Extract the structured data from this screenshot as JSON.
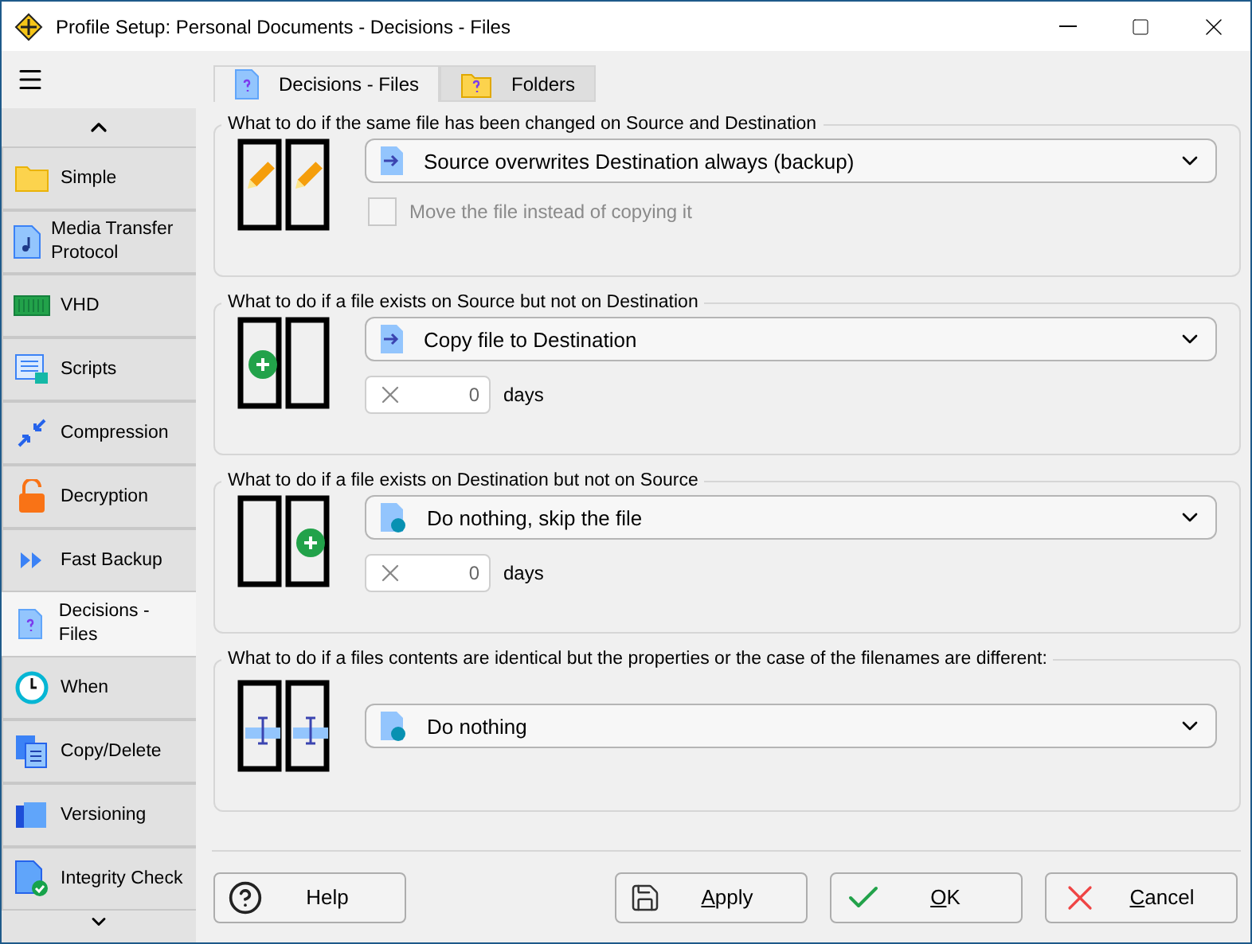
{
  "window": {
    "title": "Profile Setup: Personal Documents - Decisions - Files"
  },
  "sidebar": {
    "items": [
      {
        "label": "Simple",
        "kind": "folder",
        "selected": false
      },
      {
        "label": "Media Transfer Protocol",
        "kind": "music",
        "selected": false
      },
      {
        "label": "VHD",
        "kind": "disk",
        "selected": false
      },
      {
        "label": "Scripts",
        "kind": "script",
        "selected": false
      },
      {
        "label": "Compression",
        "kind": "compress",
        "selected": false
      },
      {
        "label": "Decryption",
        "kind": "lock",
        "selected": false
      },
      {
        "label": "Fast Backup",
        "kind": "fast",
        "selected": false
      },
      {
        "label": "Decisions - Files",
        "kind": "question",
        "selected": true
      },
      {
        "label": "When",
        "kind": "clock",
        "selected": false
      },
      {
        "label": "Copy/Delete",
        "kind": "copy",
        "selected": false
      },
      {
        "label": "Versioning",
        "kind": "versions",
        "selected": false
      },
      {
        "label": "Integrity Check",
        "kind": "check",
        "selected": false
      }
    ]
  },
  "tabs": [
    {
      "label": "Decisions - Files",
      "kind": "file",
      "selected": true
    },
    {
      "label": "Folders",
      "kind": "folder",
      "selected": false
    }
  ],
  "sections": [
    {
      "title": "What to do if the same file has been changed on Source and Destination",
      "kind": "pencils",
      "dropdown": {
        "value": "Source overwrites Destination always (backup)",
        "kind": "arrow"
      },
      "extra": {
        "kind": "checkbox",
        "label": "Move the file instead of copying it",
        "checked": false,
        "disabled": true
      }
    },
    {
      "title": "What to do if a file exists on Source but not on Destination",
      "kind": "add-left",
      "dropdown": {
        "value": "Copy file to Destination",
        "kind": "arrow"
      },
      "extra": {
        "kind": "days",
        "value": "0",
        "unit": "days"
      }
    },
    {
      "title": "What to do if a file exists on Destination but not on Source",
      "kind": "add-right",
      "dropdown": {
        "value": "Do nothing, skip the file",
        "kind": "dot"
      },
      "extra": {
        "kind": "days",
        "value": "0",
        "unit": "days"
      }
    },
    {
      "title": "What to do if a files contents are identical but the properties or the case of the filenames are different:",
      "kind": "cursors",
      "dropdown": {
        "value": "Do nothing",
        "kind": "dot"
      }
    }
  ],
  "buttons": [
    {
      "label": "Help",
      "kind": "help",
      "underlined": false
    },
    {
      "label": "Apply",
      "kind": "save",
      "underlined": true
    },
    {
      "label": "OK",
      "kind": "ok",
      "underlined": true
    },
    {
      "label": "Cancel",
      "kind": "cancel",
      "underlined": true
    }
  ]
}
